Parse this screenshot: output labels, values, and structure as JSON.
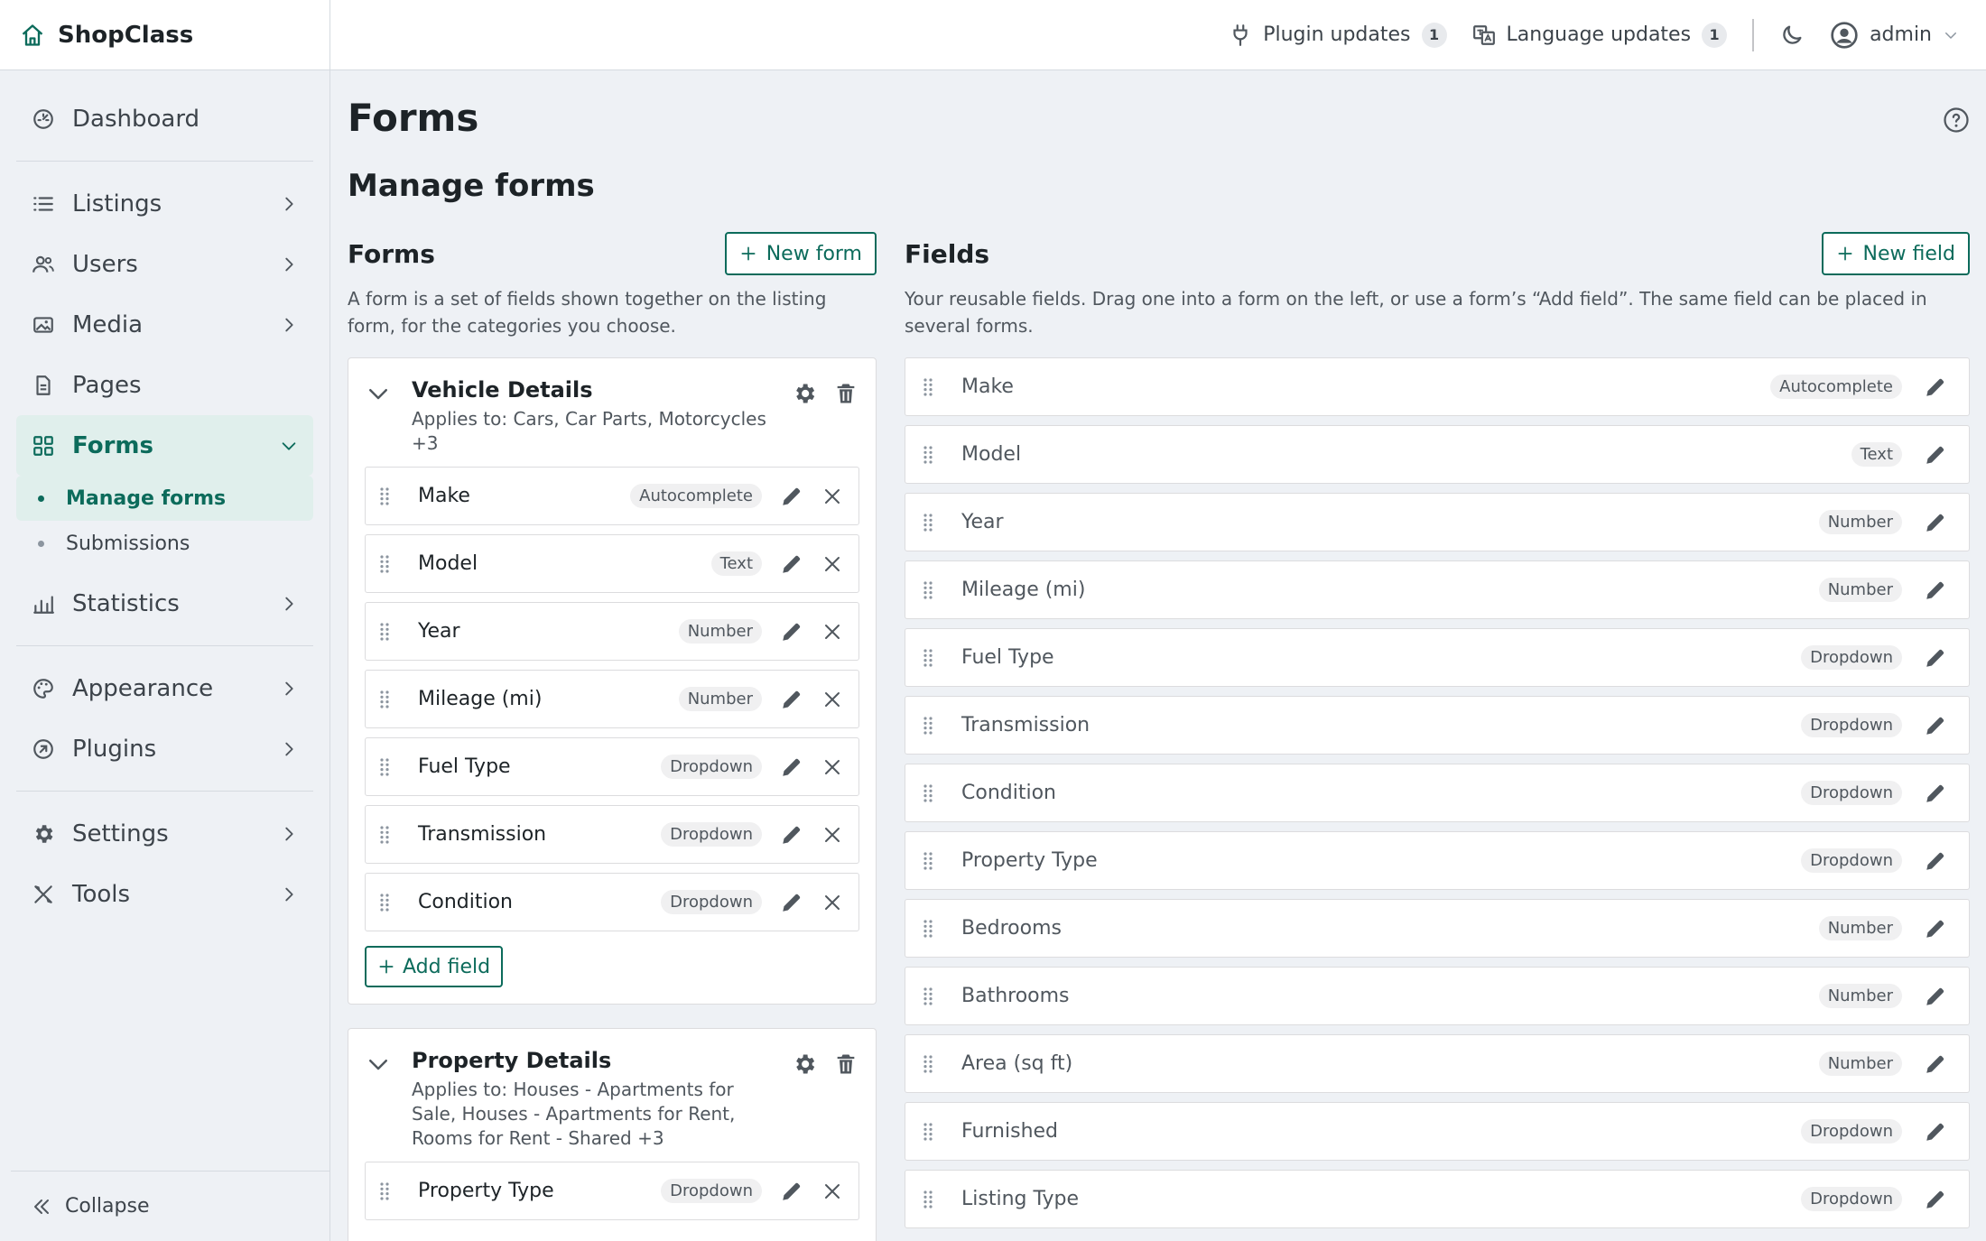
{
  "brand": {
    "name": "ShopClass"
  },
  "topbar": {
    "plugin_updates": "Plugin updates",
    "plugin_updates_count": "1",
    "language_updates": "Language updates",
    "language_updates_count": "1",
    "user": "admin"
  },
  "sidebar": {
    "dashboard": "Dashboard",
    "listings": "Listings",
    "users": "Users",
    "media": "Media",
    "pages": "Pages",
    "forms": "Forms",
    "manage_forms": "Manage forms",
    "submissions": "Submissions",
    "statistics": "Statistics",
    "appearance": "Appearance",
    "plugins": "Plugins",
    "settings": "Settings",
    "tools": "Tools",
    "collapse": "Collapse"
  },
  "page": {
    "title": "Forms",
    "section": "Manage forms"
  },
  "forms_col": {
    "title": "Forms",
    "new_button": "New form",
    "description": "A form is a set of fields shown together on the listing form, for the categories you choose.",
    "add_field": "Add field",
    "forms": [
      {
        "name": "Vehicle Details",
        "applies": "Applies to: Cars, Car Parts, Motorcycles +3",
        "fields": [
          {
            "name": "Make",
            "type": "Autocomplete"
          },
          {
            "name": "Model",
            "type": "Text"
          },
          {
            "name": "Year",
            "type": "Number"
          },
          {
            "name": "Mileage (mi)",
            "type": "Number"
          },
          {
            "name": "Fuel Type",
            "type": "Dropdown"
          },
          {
            "name": "Transmission",
            "type": "Dropdown"
          },
          {
            "name": "Condition",
            "type": "Dropdown"
          }
        ]
      },
      {
        "name": "Property Details",
        "applies": "Applies to: Houses - Apartments for Sale, Houses - Apartments for Rent, Rooms for Rent - Shared +3",
        "fields": [
          {
            "name": "Property Type",
            "type": "Dropdown"
          }
        ]
      }
    ]
  },
  "fields_col": {
    "title": "Fields",
    "new_button": "New field",
    "description": "Your reusable fields. Drag one into a form on the left, or use a form’s “Add field”. The same field can be placed in several forms.",
    "fields": [
      {
        "name": "Make",
        "type": "Autocomplete"
      },
      {
        "name": "Model",
        "type": "Text"
      },
      {
        "name": "Year",
        "type": "Number"
      },
      {
        "name": "Mileage (mi)",
        "type": "Number"
      },
      {
        "name": "Fuel Type",
        "type": "Dropdown"
      },
      {
        "name": "Transmission",
        "type": "Dropdown"
      },
      {
        "name": "Condition",
        "type": "Dropdown"
      },
      {
        "name": "Property Type",
        "type": "Dropdown"
      },
      {
        "name": "Bedrooms",
        "type": "Number"
      },
      {
        "name": "Bathrooms",
        "type": "Number"
      },
      {
        "name": "Area (sq ft)",
        "type": "Number"
      },
      {
        "name": "Furnished",
        "type": "Dropdown"
      },
      {
        "name": "Listing Type",
        "type": "Dropdown"
      }
    ]
  },
  "colors": {
    "accent": "#0c6b5b",
    "active_bg": "#e0efec",
    "page_bg": "#eef1f5"
  }
}
